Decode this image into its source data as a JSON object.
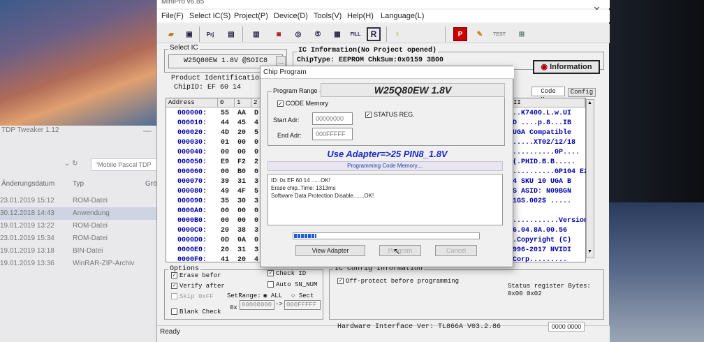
{
  "explorer": {
    "title": "TDP Tweaker 1.12",
    "search_placeholder": "\"Mobile Pascal TDP",
    "headers": [
      "Änderungsdatum",
      "Typ",
      "Grö"
    ],
    "rows": [
      {
        "date": "23.01.2019 15:12",
        "type": "ROM-Datei"
      },
      {
        "date": "30.12.2018 14:43",
        "type": "Anwendung"
      },
      {
        "date": "19.01.2019 13:22",
        "type": "ROM-Datei"
      },
      {
        "date": "23.01.2019 15:34",
        "type": "ROM-Datei"
      },
      {
        "date": "19.01.2019 13:18",
        "type": "BIN-Datei"
      },
      {
        "date": "19.01.2019 13:36",
        "type": "WinRAR-ZIP-Archiv"
      }
    ]
  },
  "app": {
    "title": "MiniPro v6.85",
    "menu": [
      "File(F)",
      "Select IC(S)",
      "Project(P)",
      "Device(D)",
      "Tools(V)",
      "Help(H)",
      "Language(L)"
    ],
    "toolbar": {
      "prj": "Prj",
      "fill": "FILL",
      "r": "R",
      "test": "TEST",
      "p": "P"
    },
    "select_ic": {
      "label": "Select IC",
      "value": "W25Q80EW 1.8V @SOIC8"
    },
    "product_id": {
      "label": "Product Identification",
      "chip_id": "ChipID:  EF 60 14"
    },
    "ic_info": {
      "label": "IC Information(No Project opened)",
      "chiptype": "ChipType:  EEPROM",
      "chksum": "ChkSum:0x0159 3B00"
    },
    "info_button": "Information",
    "tabs": {
      "code_memo": "Code Memo",
      "config": "Config"
    },
    "hex": {
      "headers": [
        "Address",
        "0",
        "1",
        "2"
      ],
      "rows": [
        {
          "addr": "000000:",
          "b": [
            "55",
            "AA",
            "D"
          ]
        },
        {
          "addr": "000010:",
          "b": [
            "44",
            "45",
            "4"
          ]
        },
        {
          "addr": "000020:",
          "b": [
            "4D",
            "20",
            "5"
          ]
        },
        {
          "addr": "000030:",
          "b": [
            "01",
            "00",
            "0"
          ]
        },
        {
          "addr": "000040:",
          "b": [
            "00",
            "00",
            "0"
          ]
        },
        {
          "addr": "000050:",
          "b": [
            "E9",
            "F2",
            "2"
          ]
        },
        {
          "addr": "000060:",
          "b": [
            "00",
            "B0",
            "0"
          ]
        },
        {
          "addr": "000070:",
          "b": [
            "39",
            "31",
            "3"
          ]
        },
        {
          "addr": "000080:",
          "b": [
            "49",
            "4F",
            "5"
          ]
        },
        {
          "addr": "000090:",
          "b": [
            "35",
            "30",
            "3"
          ]
        },
        {
          "addr": "0000A0:",
          "b": [
            "00",
            "00",
            "0"
          ]
        },
        {
          "addr": "0000B0:",
          "b": [
            "00",
            "00",
            "0"
          ]
        },
        {
          "addr": "0000C0:",
          "b": [
            "20",
            "38",
            "3"
          ]
        },
        {
          "addr": "0000D0:",
          "b": [
            "0D",
            "0A",
            "0"
          ]
        },
        {
          "addr": "0000E0:",
          "b": [
            "20",
            "31",
            "3"
          ]
        },
        {
          "addr": "0000F0:",
          "b": [
            "41",
            "20",
            "4"
          ]
        }
      ],
      "ascii_header": "II",
      "ascii": [
        "..K7400.L.w.UI",
        "D ....p.8...IB",
        "UGA Compatible",
        ".....XT02/12/18",
        "..........0P....",
        "(.PHID.B.B.....",
        "..........GP104 E2",
        "4 SKU 10 UGA B",
        "S ASID: N09BGN",
        "1GS.002$ .....",
        "",
        "...........Version",
        "6.04.8A.00.56",
        ".Copyright (C)",
        "996-2017 NVIDI",
        "Corp........."
      ]
    },
    "options": {
      "label": "Options",
      "erase_before": "Erase befor",
      "verify_after": "Verify after",
      "skip_0xff": "Skip 0xFF",
      "blank_check": "Blank Check",
      "check_id": "Check ID",
      "auto_sn": "Auto SN_NUM",
      "set_range": "SetRange:",
      "all": "ALL",
      "sect": "Sect",
      "ox": "0x",
      "range_from": "00000000",
      "range_arrow": "->",
      "range_to": "000FFFFF"
    },
    "config": {
      "label": "IC Config Information",
      "off_protect": "Off-protect before programming",
      "status_label": "Status register Bytes:",
      "status_value": "0x00 0x02"
    },
    "status_bar": {
      "ready": "Ready",
      "hw": "Hardware Interface Ver: TL866A V03.2.86",
      "counter": "0000 0000"
    }
  },
  "dialog": {
    "title": "Chip Program",
    "range_label": "Program Range",
    "code_memory": "CODE Memory",
    "chip_name": "W25Q80EW 1.8V",
    "start_label": "Start Adr:",
    "start_value": "00000000",
    "end_label": "End Adr:",
    "end_value": "000FFFFF",
    "status_reg": "STATUS REG.",
    "adapter_msg": "Use Adapter=>25 PIN8_1.8V",
    "progress_label": "Programming Code Memory....",
    "progress": 0.12,
    "log": [
      "ID: 0x EF 60 14 ......OK!",
      "Erase chip..Time: 1313ms",
      "Software Data Protection Disable.......OK!"
    ],
    "buttons": {
      "view_adapter": "View Adapter",
      "program": "Program",
      "cancel": "Cancel"
    }
  }
}
